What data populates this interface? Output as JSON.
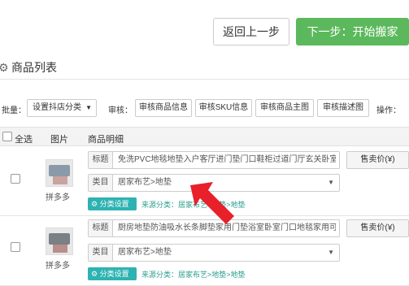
{
  "header": {
    "back_label": "返回上一步",
    "next_label": "下一步：开始搬家"
  },
  "section": {
    "title": "商品列表"
  },
  "toolbar": {
    "batch_label": "批量：",
    "batch_select": "设置抖店分类",
    "review_label": "审核：",
    "review_buttons": [
      "审核商品信息",
      "审核SKU信息",
      "审核商品主图",
      "审核描述图"
    ],
    "ops_label": "操作："
  },
  "table": {
    "select_all": "全选",
    "col_image": "图片",
    "col_detail": "商品明细"
  },
  "rows": [
    {
      "platform": "拼多多",
      "title_label": "标题",
      "title_value": "免洗PVC地毯地垫入户客厅进门垫门口鞋柜过道门厅玄关卧室",
      "category_label": "类目",
      "category_value": "居家布艺>地垫",
      "category_set_label": "分类设置",
      "source_label": "来源分类：",
      "source_value": "居家布艺>地垫>地垫",
      "price_label": "售卖价(¥)"
    },
    {
      "platform": "拼多多",
      "title_label": "标题",
      "title_value": "厨房地垫防油吸水长条脚垫家用门垫浴室卧室门口地毯家用可水洗",
      "category_label": "类目",
      "category_value": "居家布艺>地垫",
      "category_set_label": "分类设置",
      "source_label": "来源分类：",
      "source_value": "居家布艺>地垫>地垫",
      "price_label": "售卖价(¥)"
    }
  ],
  "colors": {
    "next_button": "#5cb85c",
    "category_button": "#2eb2b2",
    "source_text": "#2a9d8f",
    "arrow": "#e8202a"
  }
}
